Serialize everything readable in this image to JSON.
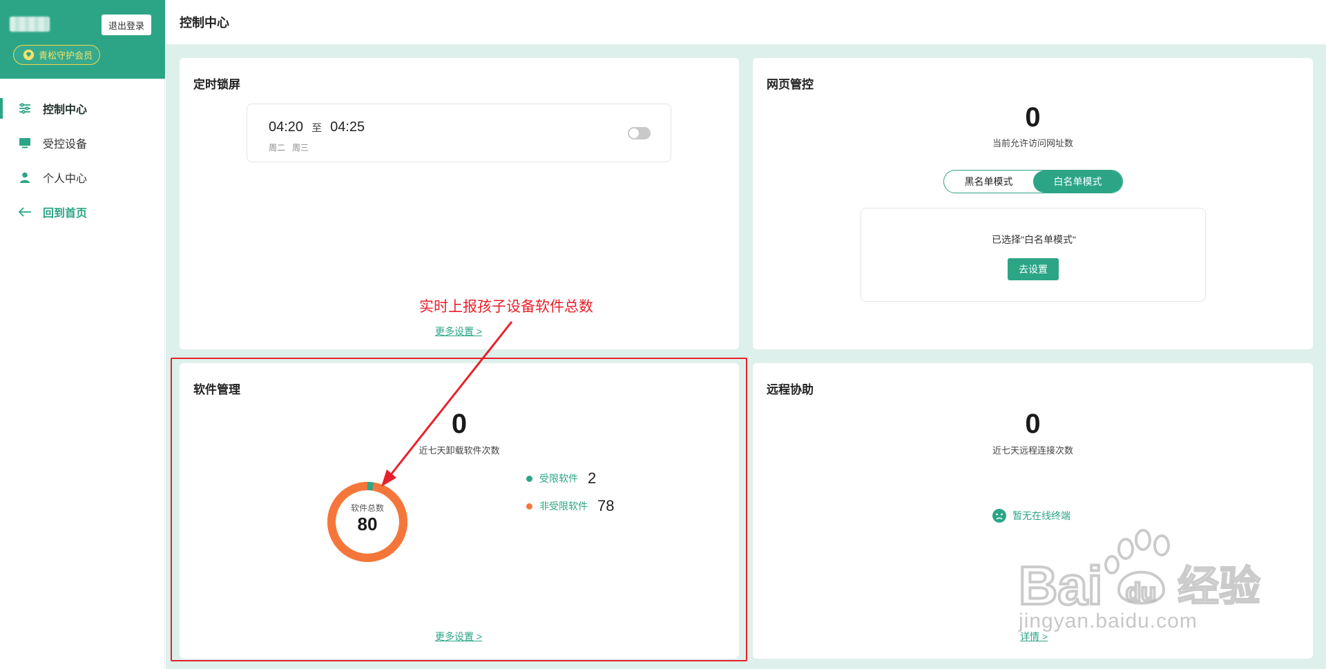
{
  "sidebar": {
    "logout_label": "退出登录",
    "member_label": "青松守护会员",
    "items": [
      {
        "label": "控制中心",
        "icon": "sliders-icon"
      },
      {
        "label": "受控设备",
        "icon": "monitor-icon"
      },
      {
        "label": "个人中心",
        "icon": "user-icon"
      },
      {
        "label": "回到首页",
        "icon": "arrow-left-icon"
      }
    ]
  },
  "header": {
    "title": "控制中心"
  },
  "lock_card": {
    "title": "定时锁屏",
    "start_time": "04:20",
    "separator": "至",
    "end_time": "04:25",
    "days": [
      "周二",
      "周三"
    ],
    "enabled": false,
    "more_link": "更多设置 >"
  },
  "web_card": {
    "title": "网页管控",
    "count": "0",
    "count_label": "当前允许访问网址数",
    "modes": [
      "黑名单模式",
      "白名单模式"
    ],
    "selected_mode": "白名单模式",
    "selected_msg": "已选择\"白名单模式\"",
    "setup_button": "去设置"
  },
  "soft_card": {
    "title": "软件管理",
    "count": "0",
    "count_label": "近七天卸载软件次数",
    "total_label": "软件总数",
    "total": "80",
    "restricted_label": "受限软件",
    "restricted_count": "2",
    "unrestricted_label": "非受限软件",
    "unrestricted_count": "78",
    "more_link": "更多设置 >"
  },
  "remote_card": {
    "title": "远程协助",
    "count": "0",
    "count_label": "近七天远程连接次数",
    "offline_msg": "暂无在线终端",
    "more_link": "详情 >"
  },
  "annotation": {
    "text": "实时上报孩子设备软件总数"
  },
  "watermark": {
    "text": "jingyan.baidu.com"
  },
  "colors": {
    "brand": "#2ba586",
    "restricted": "#2ba586",
    "unrestricted": "#f5763a",
    "annotation": "#e8202a"
  }
}
